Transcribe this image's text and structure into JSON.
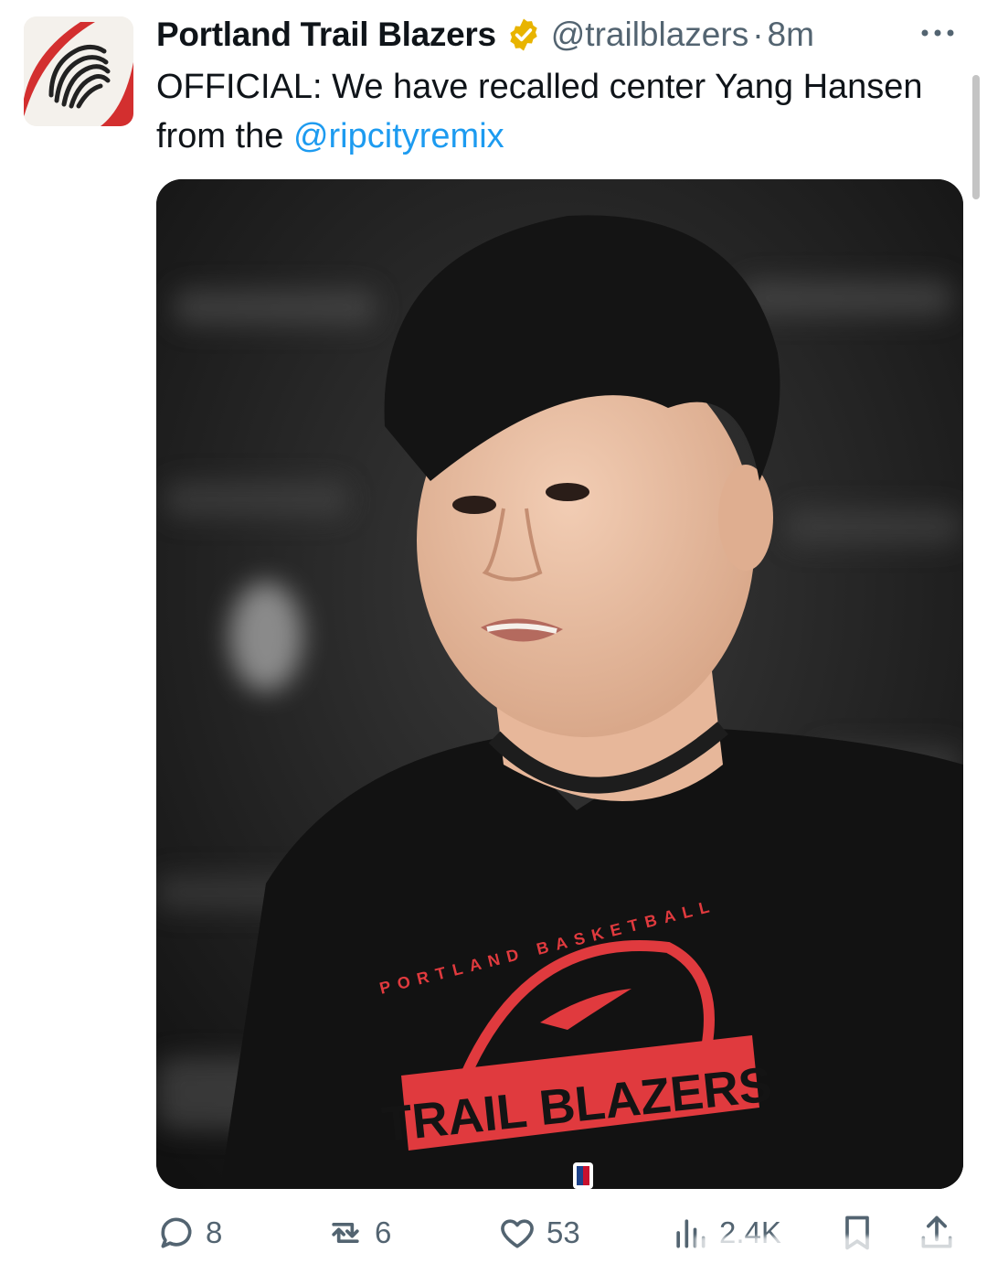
{
  "tweet": {
    "account_name": "Portland Trail Blazers",
    "handle": "@trailblazers",
    "separator": "·",
    "time_ago": "8m",
    "text_before": "OFFICIAL: We have recalled center Yang Hansen from the ",
    "mention": "@ripcityremix"
  },
  "media": {
    "shirt_arc_top": "PORTLAND BASKETBALL",
    "shirt_banner": "TRAIL BLAZERS"
  },
  "actions": {
    "replies": "8",
    "reposts": "6",
    "likes": "53",
    "views": "2.4K"
  },
  "icons": {
    "verified": "verified-badge-icon",
    "more": "more-options-icon",
    "reply": "reply-icon",
    "repost": "repost-icon",
    "like": "like-icon",
    "views": "views-icon",
    "bookmark": "bookmark-icon",
    "share": "share-icon"
  },
  "colors": {
    "mention": "#1d9bf0",
    "verified_gold": "#e8b400",
    "brand_red": "#e03a3e",
    "muted": "#536471"
  }
}
